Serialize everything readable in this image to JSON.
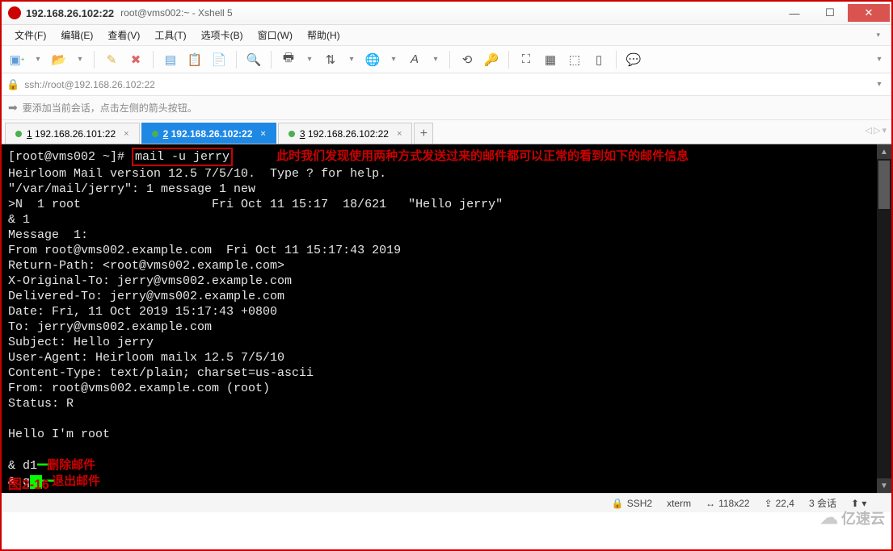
{
  "window": {
    "title_ip": "192.168.26.102:22",
    "subtitle": "root@vms002:~ - Xshell 5"
  },
  "menu": {
    "file": "文件(F)",
    "edit": "编辑(E)",
    "view": "查看(V)",
    "tools": "工具(T)",
    "tabs": "选项卡(B)",
    "window": "窗口(W)",
    "help": "帮助(H)"
  },
  "address": {
    "url": "ssh://root@192.168.26.102:22"
  },
  "hint": {
    "text": "要添加当前会话，点击左侧的箭头按钮。"
  },
  "tabs": {
    "t1": {
      "num": "1",
      "label": "192.168.26.101:22"
    },
    "t2": {
      "num": "2",
      "label": "192.168.26.102:22"
    },
    "t3": {
      "num": "3",
      "label": "192.168.26.102:22"
    },
    "add": "+"
  },
  "terminal": {
    "prompt": "[root@vms002 ~]# ",
    "cmd": "mail -u jerry",
    "annot_top": "此时我们发现使用两种方式发送过来的邮件都可以正常的看到如下的邮件信息",
    "l2": "Heirloom Mail version 12.5 7/5/10.  Type ? for help.",
    "l3": "\"/var/mail/jerry\": 1 message 1 new",
    "l4": ">N  1 root                  Fri Oct 11 15:17  18/621   \"Hello jerry\"",
    "l5": "& 1",
    "l6": "Message  1:",
    "l7": "From root@vms002.example.com  Fri Oct 11 15:17:43 2019",
    "l8": "Return-Path: <root@vms002.example.com>",
    "l9": "X-Original-To: jerry@vms002.example.com",
    "l10": "Delivered-To: jerry@vms002.example.com",
    "l11": "Date: Fri, 11 Oct 2019 15:17:43 +0800",
    "l12": "To: jerry@vms002.example.com",
    "l13": "Subject: Hello jerry",
    "l14": "User-Agent: Heirloom mailx 12.5 7/5/10",
    "l15": "Content-Type: text/plain; charset=us-ascii",
    "l16": "From: root@vms002.example.com (root)",
    "l17": "Status: R",
    "l18": "",
    "l19": "Hello I'm root",
    "l20": "",
    "l21a": "& d1",
    "annot_del": "删除邮件",
    "l22a": "& q",
    "annot_quit": "退出邮件",
    "fig": "图2-16"
  },
  "status": {
    "ssh": "SSH2",
    "term": "xterm",
    "size": "118x22",
    "pos": "22,4",
    "sessions": "3 会话",
    "lock_icon": "🔒",
    "resize_icon": "↔",
    "caps_icon": "⇪",
    "more_icon": "⬜"
  },
  "watermark": {
    "text": "亿速云"
  }
}
